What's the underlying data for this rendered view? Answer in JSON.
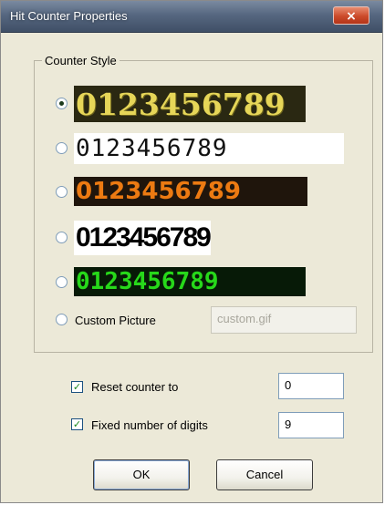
{
  "window": {
    "title": "Hit Counter Properties",
    "close_glyph": "×",
    "icons": [
      "close-icon"
    ]
  },
  "counter_style": {
    "legend": "Counter Style",
    "options": [
      {
        "digits": "0123456789",
        "checked": true
      },
      {
        "digits": "0123456789",
        "checked": false
      },
      {
        "digits": "0123456789",
        "checked": false
      },
      {
        "digits": "0123456789",
        "checked": false
      },
      {
        "digits": "0123456789",
        "checked": false
      }
    ],
    "custom": {
      "label": "Custom Picture",
      "value": "custom.gif",
      "checked": false
    }
  },
  "reset": {
    "label": "Reset counter to",
    "checked": true,
    "value": "0"
  },
  "fixed_digits": {
    "label": "Fixed number of digits",
    "checked": true,
    "value": "9"
  },
  "buttons": {
    "ok": "OK",
    "cancel": "Cancel"
  },
  "colors": {
    "title_bar": "#566780",
    "dialog_bg": "#ece9d8",
    "close_button": "#cc4a2a"
  }
}
